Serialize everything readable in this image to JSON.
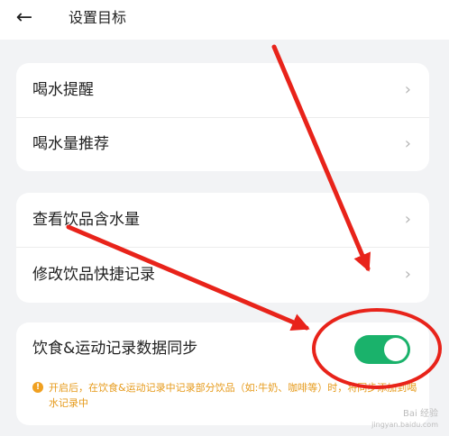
{
  "header": {
    "back_icon": "arrow-left-icon",
    "title": "设置目标"
  },
  "card1": {
    "items": [
      {
        "label": "喝水提醒"
      },
      {
        "label": "喝水量推荐"
      }
    ]
  },
  "card2": {
    "items": [
      {
        "label": "查看饮品含水量"
      },
      {
        "label": "修改饮品快捷记录"
      }
    ]
  },
  "sync": {
    "label": "饮食&运动记录数据同步",
    "enabled": true,
    "note": "开启后，在饮食&运动记录中记录部分饮品（如:牛奶、咖啡等）时，将同步添加到喝水记录中",
    "note_icon": "info-icon"
  },
  "watermark": {
    "text": "Bai 经验",
    "site": "jingyan.baidu.com"
  },
  "colors": {
    "toggle_on": "#1ab26b",
    "note": "#e69a1a",
    "annotation": "#e8231a"
  }
}
